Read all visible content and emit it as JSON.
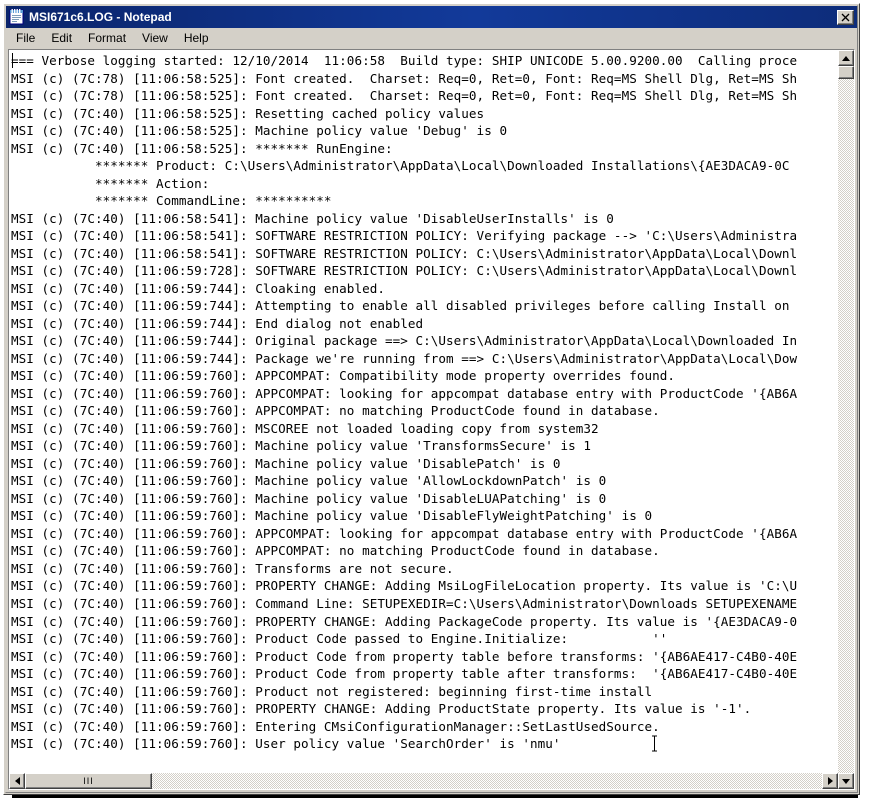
{
  "window": {
    "title": "MSI671c6.LOG - Notepad",
    "icon": "notepad-icon",
    "close_label": "✕"
  },
  "menu": {
    "items": [
      {
        "label": "File"
      },
      {
        "label": "Edit"
      },
      {
        "label": "Format"
      },
      {
        "label": "View"
      },
      {
        "label": "Help"
      }
    ]
  },
  "scrollbars": {
    "vertical": {
      "up_label": "",
      "down_label": "",
      "thumb_label": ""
    },
    "horizontal": {
      "left_label": "‹",
      "right_label": "›",
      "thumb_grip": "III"
    }
  },
  "document": {
    "lines": [
      "=== Verbose logging started: 12/10/2014  11:06:58  Build type: SHIP UNICODE 5.00.9200.00  Calling proce",
      "MSI (c) (7C:78) [11:06:58:525]: Font created.  Charset: Req=0, Ret=0, Font: Req=MS Shell Dlg, Ret=MS Sh",
      "MSI (c) (7C:78) [11:06:58:525]: Font created.  Charset: Req=0, Ret=0, Font: Req=MS Shell Dlg, Ret=MS Sh",
      "MSI (c) (7C:40) [11:06:58:525]: Resetting cached policy values",
      "MSI (c) (7C:40) [11:06:58:525]: Machine policy value 'Debug' is 0",
      "MSI (c) (7C:40) [11:06:58:525]: ******* RunEngine:",
      "           ******* Product: C:\\Users\\Administrator\\AppData\\Local\\Downloaded Installations\\{AE3DACA9-0C",
      "           ******* Action:",
      "           ******* CommandLine: **********",
      "MSI (c) (7C:40) [11:06:58:541]: Machine policy value 'DisableUserInstalls' is 0",
      "MSI (c) (7C:40) [11:06:58:541]: SOFTWARE RESTRICTION POLICY: Verifying package --> 'C:\\Users\\Administra",
      "MSI (c) (7C:40) [11:06:58:541]: SOFTWARE RESTRICTION POLICY: C:\\Users\\Administrator\\AppData\\Local\\Downl",
      "MSI (c) (7C:40) [11:06:59:728]: SOFTWARE RESTRICTION POLICY: C:\\Users\\Administrator\\AppData\\Local\\Downl",
      "MSI (c) (7C:40) [11:06:59:744]: Cloaking enabled.",
      "MSI (c) (7C:40) [11:06:59:744]: Attempting to enable all disabled privileges before calling Install on",
      "MSI (c) (7C:40) [11:06:59:744]: End dialog not enabled",
      "MSI (c) (7C:40) [11:06:59:744]: Original package ==> C:\\Users\\Administrator\\AppData\\Local\\Downloaded In",
      "MSI (c) (7C:40) [11:06:59:744]: Package we're running from ==> C:\\Users\\Administrator\\AppData\\Local\\Dow",
      "MSI (c) (7C:40) [11:06:59:760]: APPCOMPAT: Compatibility mode property overrides found.",
      "MSI (c) (7C:40) [11:06:59:760]: APPCOMPAT: looking for appcompat database entry with ProductCode '{AB6A",
      "MSI (c) (7C:40) [11:06:59:760]: APPCOMPAT: no matching ProductCode found in database.",
      "MSI (c) (7C:40) [11:06:59:760]: MSCOREE not loaded loading copy from system32",
      "MSI (c) (7C:40) [11:06:59:760]: Machine policy value 'TransformsSecure' is 1",
      "MSI (c) (7C:40) [11:06:59:760]: Machine policy value 'DisablePatch' is 0",
      "MSI (c) (7C:40) [11:06:59:760]: Machine policy value 'AllowLockdownPatch' is 0",
      "MSI (c) (7C:40) [11:06:59:760]: Machine policy value 'DisableLUAPatching' is 0",
      "MSI (c) (7C:40) [11:06:59:760]: Machine policy value 'DisableFlyWeightPatching' is 0",
      "MSI (c) (7C:40) [11:06:59:760]: APPCOMPAT: looking for appcompat database entry with ProductCode '{AB6A",
      "MSI (c) (7C:40) [11:06:59:760]: APPCOMPAT: no matching ProductCode found in database.",
      "MSI (c) (7C:40) [11:06:59:760]: Transforms are not secure.",
      "MSI (c) (7C:40) [11:06:59:760]: PROPERTY CHANGE: Adding MsiLogFileLocation property. Its value is 'C:\\U",
      "MSI (c) (7C:40) [11:06:59:760]: Command Line: SETUPEXEDIR=C:\\Users\\Administrator\\Downloads SETUPEXENAME",
      "MSI (c) (7C:40) [11:06:59:760]: PROPERTY CHANGE: Adding PackageCode property. Its value is '{AE3DACA9-0",
      "MSI (c) (7C:40) [11:06:59:760]: Product Code passed to Engine.Initialize:           ''",
      "MSI (c) (7C:40) [11:06:59:760]: Product Code from property table before transforms: '{AB6AE417-C4B0-40E",
      "MSI (c) (7C:40) [11:06:59:760]: Product Code from property table after transforms:  '{AB6AE417-C4B0-40E",
      "MSI (c) (7C:40) [11:06:59:760]: Product not registered: beginning first-time install",
      "MSI (c) (7C:40) [11:06:59:760]: PROPERTY CHANGE: Adding ProductState property. Its value is '-1'.",
      "MSI (c) (7C:40) [11:06:59:760]: Entering CMsiConfigurationManager::SetLastUsedSource.",
      "MSI (c) (7C:40) [11:06:59:760]: User policy value 'SearchOrder' is 'nmu'"
    ]
  },
  "colors": {
    "titlebar_start": "#0a246a",
    "titlebar_end": "#0d2c7a",
    "face": "#d4d0c8",
    "text": "#000000",
    "client_bg": "#ffffff"
  }
}
